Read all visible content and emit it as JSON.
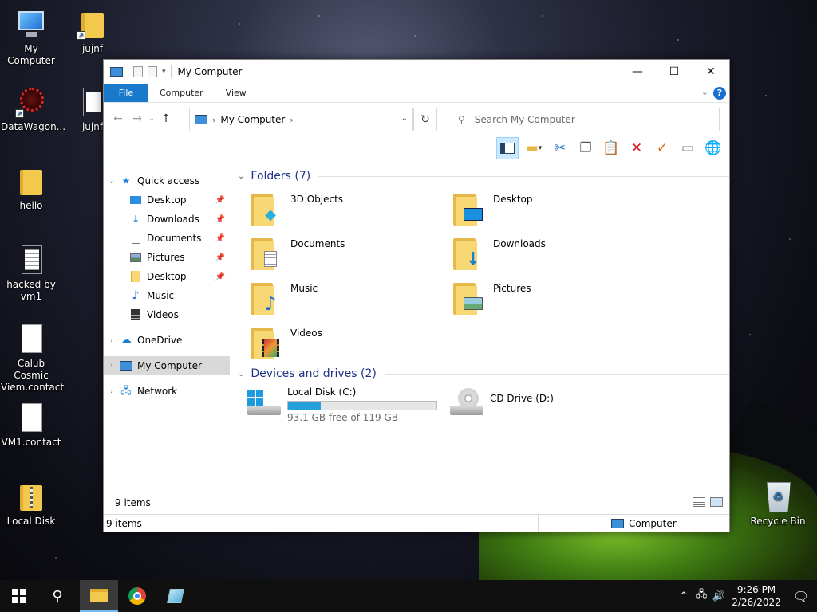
{
  "desktop": {
    "icons": [
      {
        "label": "My Computer",
        "icon": "computer-icon"
      },
      {
        "label": "jujnf",
        "icon": "folder-shortcut-icon"
      },
      {
        "label": "DataWagon...",
        "icon": "app-shortcut-icon"
      },
      {
        "label": "jujnf",
        "icon": "text-document-icon"
      },
      {
        "label": "hello",
        "icon": "folder-icon"
      },
      {
        "label": "hacked by vm1",
        "icon": "text-document-icon"
      },
      {
        "label": "Calub Cosmic Viem.contact",
        "icon": "contact-file-icon"
      },
      {
        "label": "VM1.contact",
        "icon": "contact-file-icon"
      },
      {
        "label": "Local Disk",
        "icon": "zip-folder-icon"
      },
      {
        "label": "Recycle Bin",
        "icon": "recycle-bin-icon"
      }
    ]
  },
  "window": {
    "title": "My Computer",
    "controls": {
      "minimize": "—",
      "maximize": "☐",
      "close": "✕"
    },
    "ribbon_tabs": [
      "File",
      "Computer",
      "View"
    ],
    "help_label": "?",
    "address": {
      "location": "My Computer"
    },
    "search": {
      "placeholder": "Search My Computer"
    },
    "nav_pane": {
      "quick_access": "Quick access",
      "items": [
        {
          "label": "Desktop",
          "icon": "desktop-icon",
          "pinned": true
        },
        {
          "label": "Downloads",
          "icon": "download-icon",
          "pinned": true
        },
        {
          "label": "Documents",
          "icon": "documents-icon",
          "pinned": true
        },
        {
          "label": "Pictures",
          "icon": "pictures-icon",
          "pinned": true
        },
        {
          "label": "Desktop",
          "icon": "folder-icon",
          "pinned": true
        },
        {
          "label": "Music",
          "icon": "music-icon",
          "pinned": false
        },
        {
          "label": "Videos",
          "icon": "videos-icon",
          "pinned": false
        }
      ],
      "onedrive": "OneDrive",
      "my_computer": "My Computer",
      "network": "Network"
    },
    "folders_header": "Folders (7)",
    "folders": [
      {
        "name": "3D Objects",
        "icon": "3d-objects-icon"
      },
      {
        "name": "Desktop",
        "icon": "desktop-icon"
      },
      {
        "name": "Documents",
        "icon": "documents-icon"
      },
      {
        "name": "Downloads",
        "icon": "download-icon"
      },
      {
        "name": "Music",
        "icon": "music-icon"
      },
      {
        "name": "Pictures",
        "icon": "pictures-icon"
      },
      {
        "name": "Videos",
        "icon": "videos-icon"
      }
    ],
    "devices_header": "Devices and drives (2)",
    "drives": [
      {
        "name": "Local Disk (C:)",
        "free_text": "93.1 GB free of 119 GB",
        "used_fraction": 0.218
      },
      {
        "name": "CD Drive (D:)"
      }
    ],
    "status": {
      "items": "9 items",
      "bottom_items": "9 items",
      "bottom_location": "Computer"
    }
  },
  "taskbar": {
    "time": "9:26 PM",
    "date": "2/26/2022"
  },
  "colors": {
    "accent": "#1979ca",
    "drive_bar": "#26a0da",
    "header_text": "#1e3287"
  }
}
